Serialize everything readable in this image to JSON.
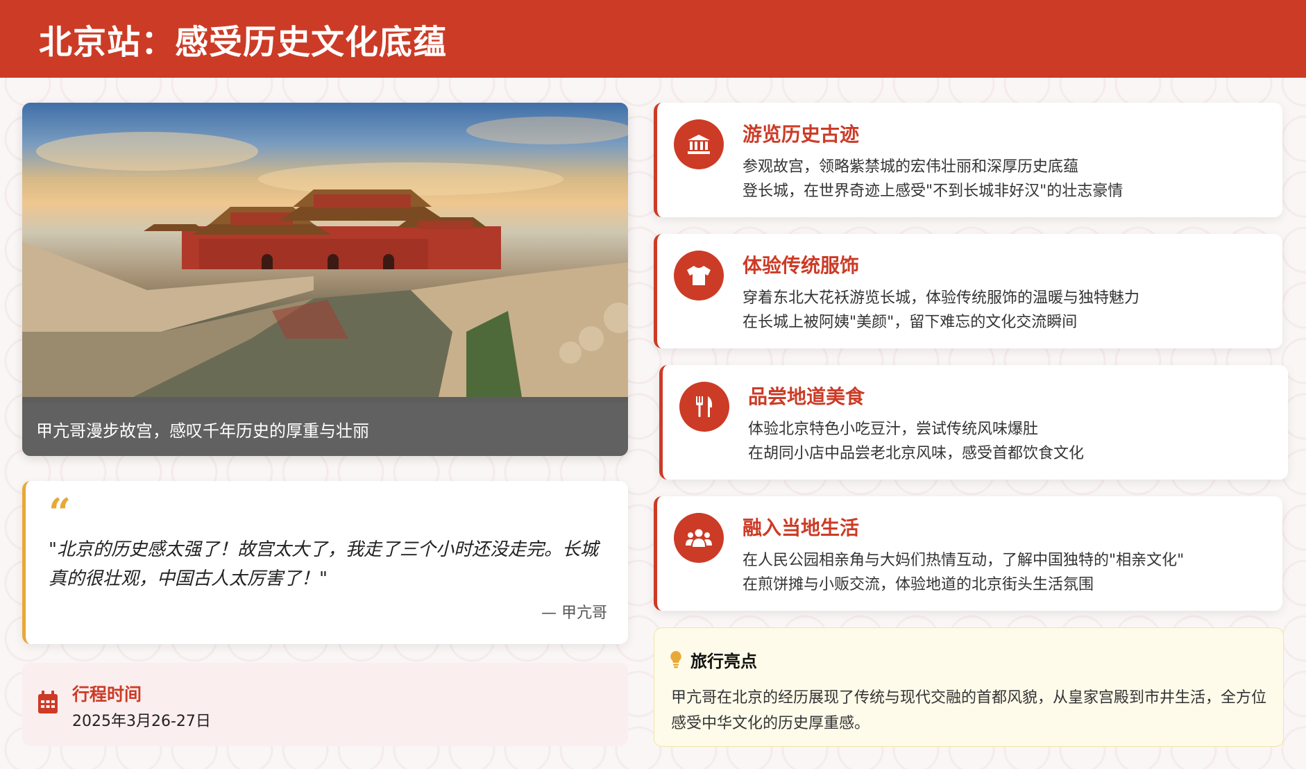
{
  "header": {
    "title": "北京站：感受历史文化底蕴"
  },
  "photo": {
    "caption": "甲亢哥漫步故宫，感叹千年历史的厚重与壮丽"
  },
  "quote": {
    "mark": "“",
    "text": "\"北京的历史感太强了！故宫太大了，我走了三个小时还没走完。长城真的很壮观，中国古人太厉害了！\"",
    "author": "— 甲亢哥"
  },
  "schedule": {
    "label": "行程时间",
    "value": "2025年3月26-27日",
    "icon": "calendar-icon"
  },
  "activities": [
    {
      "icon": "landmark-icon",
      "title": "游览历史古迹",
      "lines": [
        "参观故宫，领略紫禁城的宏伟壮丽和深厚历史底蕴",
        "登长城，在世界奇迹上感受\"不到长城非好汉\"的壮志豪情"
      ]
    },
    {
      "icon": "tshirt-icon",
      "title": "体验传统服饰",
      "lines": [
        "穿着东北大花袄游览长城，体验传统服饰的温暖与独特魅力",
        "在长城上被阿姨\"美颜\"，留下难忘的文化交流瞬间"
      ]
    },
    {
      "icon": "utensils-icon",
      "title": "品尝地道美食",
      "lines": [
        "体验北京特色小吃豆汁，尝试传统风味爆肚",
        "在胡同小店中品尝老北京风味，感受首都饮食文化"
      ]
    },
    {
      "icon": "people-group-icon",
      "title": "融入当地生活",
      "lines": [
        "在人民公园相亲角与大妈们热情互动，了解中国独特的\"相亲文化\"",
        "在煎饼摊与小贩交流，体验地道的北京街头生活氛围"
      ]
    }
  ],
  "highlight": {
    "icon": "lightbulb-icon",
    "title": "旅行亮点",
    "text": "甲亢哥在北京的经历展现了传统与现代交融的首都风貌，从皇家宫殿到市井生活，全方位感受中华文化的历史厚重感。"
  },
  "colors": {
    "primary": "#cc3b26",
    "accent": "#e8a838",
    "highlight_bg": "#fffbea"
  }
}
